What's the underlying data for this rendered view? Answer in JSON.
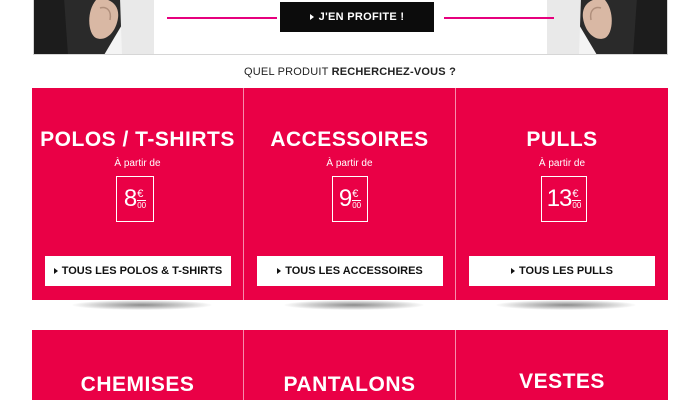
{
  "banner": {
    "cta_label": "J'EN PROFITE !",
    "accent_color": "#e6007e"
  },
  "question": {
    "prefix": "QUEL PRODUIT ",
    "bold": "RECHERCHEZ-VOUS ?"
  },
  "tile_color": "#ea0046",
  "categories_row1": [
    {
      "title": "POLOS / T-SHIRTS",
      "from_label": "À partir de",
      "price_int": "8",
      "price_currency": "€",
      "price_cents": "00",
      "button": "TOUS LES POLOS & T-SHIRTS"
    },
    {
      "title": "ACCESSOIRES",
      "from_label": "À partir de",
      "price_int": "9",
      "price_currency": "€",
      "price_cents": "00",
      "button": "TOUS LES ACCESSOIRES"
    },
    {
      "title": "PULLS",
      "from_label": "À partir de",
      "price_int": "13",
      "price_currency": "€",
      "price_cents": "00",
      "button": "TOUS LES PULLS"
    }
  ],
  "categories_row2": [
    {
      "title": "CHEMISES"
    },
    {
      "title": "PANTALONS"
    },
    {
      "title": "VESTES"
    }
  ]
}
